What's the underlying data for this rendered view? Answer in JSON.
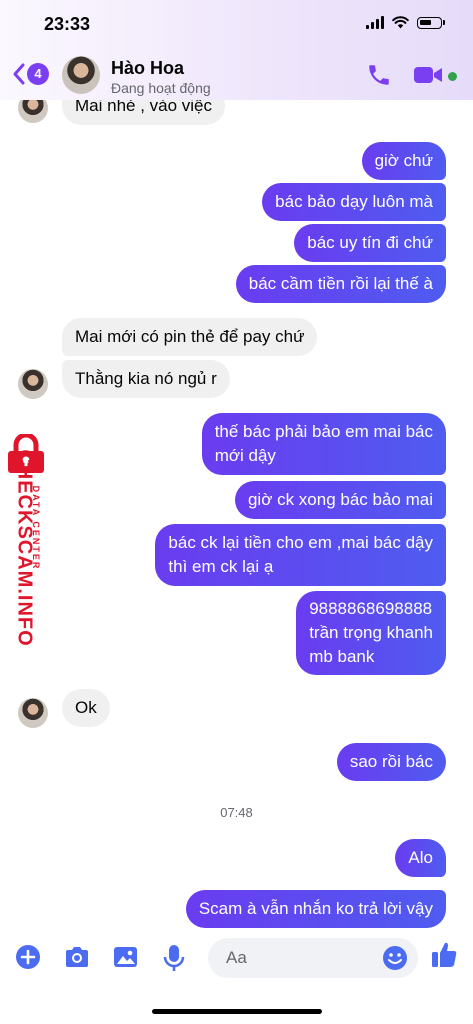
{
  "status_bar": {
    "time": "23:33"
  },
  "header": {
    "back_badge": "4",
    "contact_name": "Hào Hoa",
    "contact_status": "Đang hoạt động"
  },
  "messages": [
    {
      "side": "in",
      "text": "Mai nhé , vào việc",
      "avatar": true
    },
    {
      "side": "out",
      "text": "giờ chứ"
    },
    {
      "side": "out",
      "text": "bác bảo dạy luôn mà"
    },
    {
      "side": "out",
      "text": "bác uy tín đi chứ"
    },
    {
      "side": "out",
      "text": "bác cầm tiền rồi lại thế à"
    },
    {
      "side": "in",
      "text": "Mai mới có pin thẻ để pay chứ"
    },
    {
      "side": "in",
      "text": "Thằng kia nó ngủ r",
      "avatar": true
    },
    {
      "side": "out",
      "lines": [
        "thế bác phải bảo em mai bác",
        "mới dậy"
      ]
    },
    {
      "side": "out",
      "text": "giờ ck xong bác bảo mai"
    },
    {
      "side": "out",
      "lines": [
        "bác ck lại tiền cho em ,mai bác dậy",
        "thì em ck lại ạ"
      ]
    },
    {
      "side": "out",
      "lines": [
        "9888868698888",
        "trần trọng khanh",
        "mb bank"
      ]
    },
    {
      "side": "in",
      "text": "Ok",
      "avatar": true
    },
    {
      "side": "out",
      "text": "sao rồi bác"
    },
    {
      "side": "out",
      "text": "Alo"
    },
    {
      "side": "out",
      "text": "Scam à vẫn nhắn ko trả lời vậy"
    }
  ],
  "timestamp": "07:48",
  "watermark": {
    "brand": "CHECKSCAM.INFO",
    "sub": "DATA CENTER"
  },
  "composer": {
    "placeholder": "Aa"
  },
  "colors": {
    "accent": "#7b3ff2",
    "outgoing_start": "#6a3cf0",
    "outgoing_end": "#4f5cf0",
    "incoming": "#f0f0f0",
    "online": "#31a24c"
  },
  "icons": [
    "back-chevron-icon",
    "phone-icon",
    "video-icon",
    "plus-icon",
    "camera-icon",
    "gallery-icon",
    "microphone-icon",
    "emoji-icon",
    "like-thumb-icon",
    "lock-icon"
  ]
}
